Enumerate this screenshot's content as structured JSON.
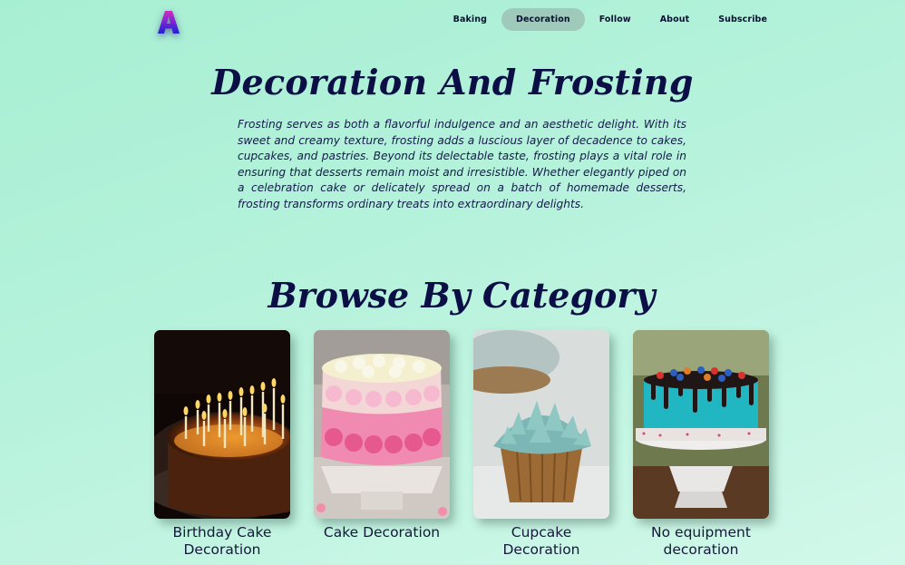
{
  "nav": {
    "items": [
      {
        "label": "Baking",
        "active": false
      },
      {
        "label": "Decoration",
        "active": true
      },
      {
        "label": "Follow",
        "active": false
      },
      {
        "label": "About",
        "active": false
      },
      {
        "label": "Subscribe",
        "active": false
      }
    ]
  },
  "logo": {
    "letter": "A"
  },
  "hero": {
    "title": "Decoration And Frosting",
    "description": "Frosting serves as both a flavorful indulgence and an aesthetic delight. With its sweet and creamy texture, frosting adds a luscious layer of decadence to cakes, cupcakes, and pastries. Beyond its delectable taste, frosting plays a vital role in ensuring that desserts remain moist and irresistible. Whether elegantly piped on a celebration cake or delicately spread on a batch of homemade desserts, frosting transforms ordinary treats into extraordinary delights."
  },
  "categories": {
    "title": "Browse By Category",
    "items": [
      {
        "label": "Birthday Cake Decoration",
        "image": "birthday-cake-photo"
      },
      {
        "label": "Cake Decoration",
        "image": "rosette-cake-photo"
      },
      {
        "label": "Cupcake Decoration",
        "image": "cupcake-photo"
      },
      {
        "label": "No equipment decoration",
        "image": "drip-cake-photo"
      }
    ]
  },
  "colors": {
    "text": "#0b0f45",
    "nav_active": "#9fcabb",
    "background_start": "#a7efd3",
    "background_end": "#d2f8ea"
  }
}
